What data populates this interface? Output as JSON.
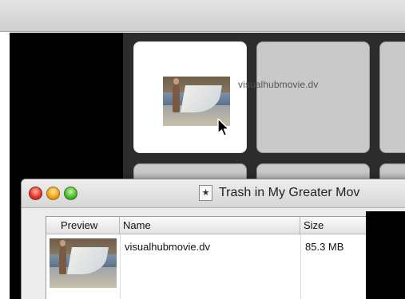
{
  "grid": {
    "tiles": [
      {
        "label": "visualhubmovie.dv",
        "selected": true
      }
    ]
  },
  "trash_window": {
    "title": "Trash in My Greater Mov",
    "title_icon": "star-document-icon",
    "columns": [
      "Preview",
      "Name",
      "Size"
    ],
    "rows": [
      {
        "name": "visualhubmovie.dv",
        "size": "85.3 MB"
      }
    ]
  },
  "colors": {
    "close": "#e3392b",
    "minimize": "#f0a81a",
    "zoom": "#4fbf2c"
  }
}
